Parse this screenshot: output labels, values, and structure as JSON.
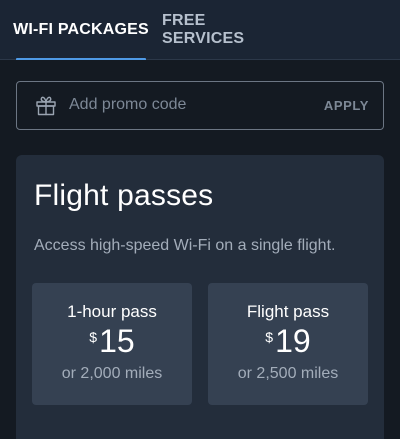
{
  "tabs": [
    {
      "label": "WI-FI PACKAGES",
      "active": true
    },
    {
      "label": "FREE SERVICES",
      "active": false
    }
  ],
  "promo": {
    "icon": "gift-icon",
    "placeholder": "Add promo code",
    "value": "",
    "apply_label": "APPLY"
  },
  "flight_passes": {
    "title": "Flight passes",
    "description": "Access high-speed Wi-Fi on a single flight.",
    "passes": [
      {
        "name": "1-hour pass",
        "currency": "$",
        "price": "15",
        "miles": "or 2,000 miles"
      },
      {
        "name": "Flight pass",
        "currency": "$",
        "price": "19",
        "miles": "or 2,500 miles"
      }
    ]
  },
  "colors": {
    "accent": "#4f9ae6",
    "background": "#141a22",
    "card": "#232d3b",
    "pass_card": "#354152",
    "muted_text": "#a3adba"
  }
}
